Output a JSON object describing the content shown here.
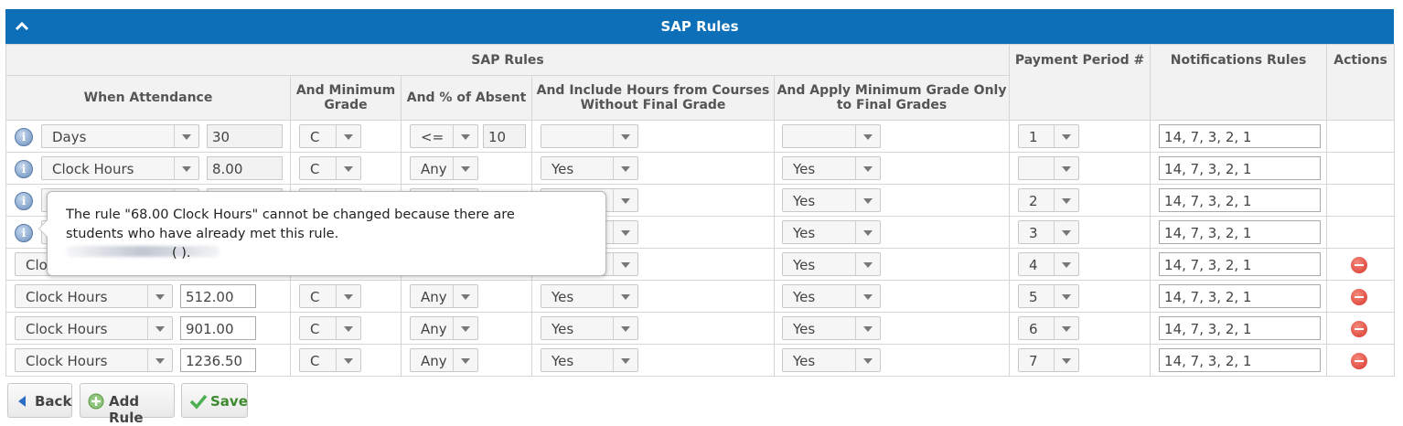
{
  "panel": {
    "title": "SAP Rules",
    "collapse_icon": "chevron-up-icon"
  },
  "table": {
    "group_header": "SAP Rules",
    "columns": {
      "when_attendance": "When Attendance",
      "min_grade": "And Minimum Grade",
      "pct_absent": "And % of Absent",
      "include_hours": "And Include Hours from Courses Without Final Grade",
      "apply_min_grade": "And Apply Minimum Grade Only to Final Grades",
      "payment_period": "Payment Period #",
      "notifications": "Notifications Rules",
      "actions": "Actions"
    },
    "rows": [
      {
        "info": true,
        "unit": "Days",
        "amount": "30",
        "grade": "C",
        "absent_op": "<=",
        "absent_val": "10",
        "include": "",
        "apply": "",
        "period": "1",
        "notify": "14, 7, 3, 2, 1",
        "removable": false,
        "readonly": true
      },
      {
        "info": true,
        "unit": "Clock Hours",
        "amount": "8.00",
        "grade": "C",
        "absent_op": "Any",
        "absent_val": "",
        "include": "Yes",
        "apply": "Yes",
        "period": "",
        "notify": "14, 7, 3, 2, 1",
        "removable": false,
        "readonly": true
      },
      {
        "info": true,
        "unit": "",
        "amount": "",
        "grade": "",
        "absent_op": "",
        "absent_val": "",
        "include": "",
        "apply": "Yes",
        "period": "2",
        "notify": "14, 7, 3, 2, 1",
        "removable": false,
        "readonly": true
      },
      {
        "info": true,
        "unit": "",
        "amount": "",
        "grade": "",
        "absent_op": "",
        "absent_val": "",
        "include": "",
        "apply": "Yes",
        "period": "3",
        "notify": "14, 7, 3, 2, 1",
        "removable": false,
        "readonly": true
      },
      {
        "info": false,
        "unit": "Clo",
        "amount": "",
        "grade": "",
        "absent_op": "",
        "absent_val": "",
        "include": "",
        "apply": "Yes",
        "period": "4",
        "notify": "14, 7, 3, 2, 1",
        "removable": true,
        "readonly": false
      },
      {
        "info": false,
        "unit": "Clock Hours",
        "amount": "512.00",
        "grade": "C",
        "absent_op": "Any",
        "absent_val": "",
        "include": "Yes",
        "apply": "Yes",
        "period": "5",
        "notify": "14, 7, 3, 2, 1",
        "removable": true,
        "readonly": false
      },
      {
        "info": false,
        "unit": "Clock Hours",
        "amount": "901.00",
        "grade": "C",
        "absent_op": "Any",
        "absent_val": "",
        "include": "Yes",
        "apply": "Yes",
        "period": "6",
        "notify": "14, 7, 3, 2, 1",
        "removable": true,
        "readonly": false
      },
      {
        "info": false,
        "unit": "Clock Hours",
        "amount": "1236.50",
        "grade": "C",
        "absent_op": "Any",
        "absent_val": "",
        "include": "Yes",
        "apply": "Yes",
        "period": "7",
        "notify": "14, 7, 3, 2, 1",
        "removable": true,
        "readonly": false
      }
    ]
  },
  "tooltip": {
    "message": "The rule \"68.00 Clock Hours\" cannot be changed because there are students who have already met this rule.",
    "tail": "(      )."
  },
  "buttons": {
    "back": "Back",
    "add_rule": "Add Rule",
    "save": "Save"
  },
  "colors": {
    "header_bg": "#0d6fb8",
    "remove": "#d9342b",
    "save_icon": "#4caf50",
    "back_icon": "#2b6cc4"
  }
}
